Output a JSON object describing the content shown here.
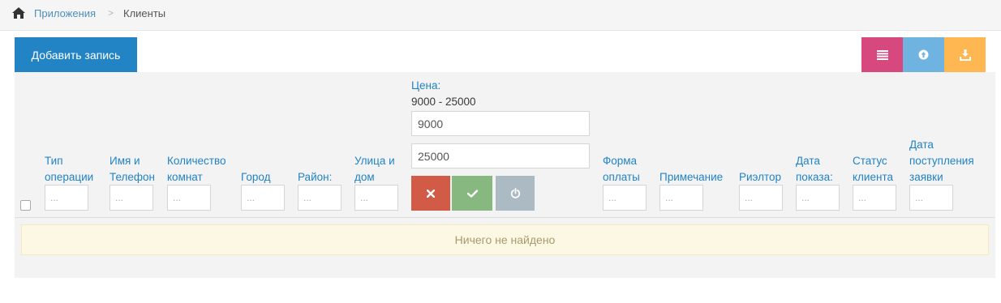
{
  "breadcrumb": {
    "home_icon": "home-icon",
    "items": [
      "Приложения",
      "Клиенты"
    ],
    "separator": ">"
  },
  "toolbar": {
    "add_label": "Добавить запись",
    "buttons": [
      {
        "icon": "list-icon",
        "color": "#d6487e"
      },
      {
        "icon": "upload-icon",
        "color": "#6fb3e0"
      },
      {
        "icon": "download-icon",
        "color": "#ffb752"
      }
    ]
  },
  "filters": {
    "placeholder": "...",
    "columns": [
      {
        "label_lines": [
          "Тип",
          "операции"
        ]
      },
      {
        "label_lines": [
          "Имя и",
          "Телефон"
        ]
      },
      {
        "label_lines": [
          "Количество",
          "комнат"
        ]
      },
      {
        "label_lines": [
          "Город"
        ]
      },
      {
        "label_lines": [
          "Район:"
        ]
      },
      {
        "label_lines": [
          "Улица и",
          "дом"
        ]
      },
      {
        "label_lines": [
          "Форма",
          "оплаты"
        ]
      },
      {
        "label_lines": [
          "Примечание"
        ]
      },
      {
        "label_lines": [
          "Риэлтор"
        ]
      },
      {
        "label_lines": [
          "Дата",
          "показа:"
        ]
      },
      {
        "label_lines": [
          "Статус",
          "клиента"
        ]
      },
      {
        "label_lines": [
          "Дата",
          "поступления",
          "заявки"
        ]
      }
    ],
    "price": {
      "label": "Цена:",
      "range": "9000 - 25000",
      "min_value": "9000",
      "max_value": "25000"
    },
    "actions": [
      {
        "icon": "close-icon",
        "color": "#d15b47"
      },
      {
        "icon": "check-icon",
        "color": "#87b87f"
      },
      {
        "icon": "power-icon",
        "color": "#abbac3"
      }
    ]
  },
  "table": {
    "empty_message": "Ничего не найдено"
  }
}
